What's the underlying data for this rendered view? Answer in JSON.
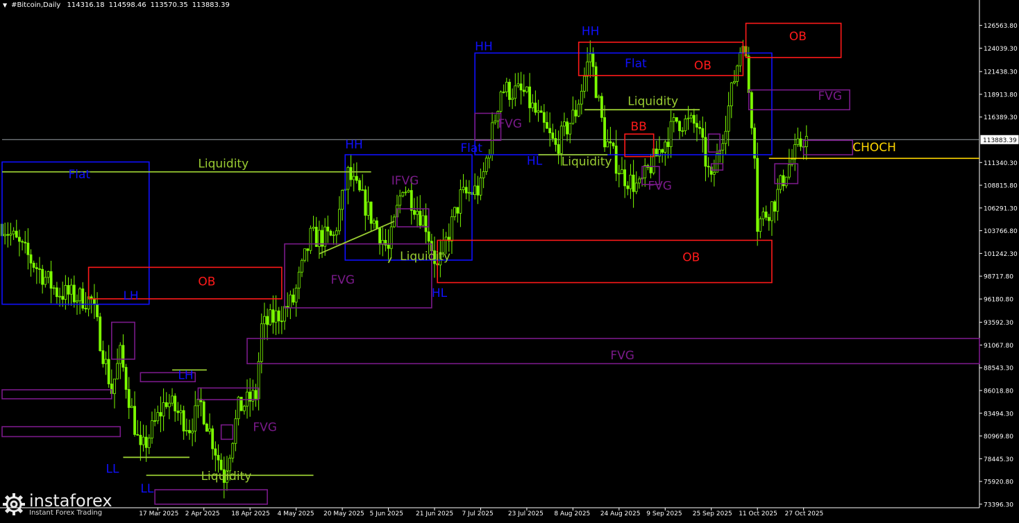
{
  "header": {
    "menu_icon": "triangle-down-icon",
    "symbol": "#Bitcoin,Daily",
    "ohlc": [
      "114316.18",
      "114598.46",
      "113570.35",
      "113883.39"
    ]
  },
  "current_price": "113883.39",
  "colors": {
    "background": "#000000",
    "candle": "#7CFC00",
    "grid_axis": "#ffffff",
    "blue_zone": "#1010ff",
    "red_zone": "#ff1a1a",
    "purple_zone": "#7a1a8a",
    "liquidity": "#9acd32",
    "choch": "#ffd700",
    "price_line": "#9aa0a6"
  },
  "logo": {
    "icon": "gear-logo-icon",
    "name": "instaforex",
    "tagline": "Instant Forex Trading"
  },
  "chart_data": {
    "type": "candlestick",
    "title": "",
    "symbol": "#Bitcoin",
    "timeframe": "Daily",
    "ylim": [
      73000,
      128000
    ],
    "y_ticks": [
      "126563.80",
      "124039.30",
      "121438.30",
      "118913.80",
      "116389.30",
      "113883.39",
      "111340.30",
      "108815.80",
      "106291.30",
      "103766.80",
      "101242.30",
      "98717.80",
      "96180.80",
      "93592.30",
      "91067.80",
      "88543.30",
      "86018.80",
      "83494.30",
      "80969.80",
      "78445.30",
      "75920.80",
      "73396.30"
    ],
    "x_ticks": [
      "17 Mar 2025",
      "2 Apr 2025",
      "18 Apr 2025",
      "4 May 2025",
      "20 May 2025",
      "5 Jun 2025",
      "21 Jun 2025",
      "7 Jul 2025",
      "23 Jul 2025",
      "8 Aug 2025",
      "24 Aug 2025",
      "9 Sep 2025",
      "25 Sep 2025",
      "11 Oct 2025",
      "27 Oct 2025"
    ],
    "price_path": [
      [
        "2025-01-22",
        104500
      ],
      [
        "2025-02-01",
        100500
      ],
      [
        "2025-02-10",
        97000
      ],
      [
        "2025-02-22",
        96000
      ],
      [
        "2025-03-01",
        86000
      ],
      [
        "2025-03-04",
        90000
      ],
      [
        "2025-03-11",
        79000
      ],
      [
        "2025-03-20",
        85000
      ],
      [
        "2025-03-28",
        82000
      ],
      [
        "2025-04-01",
        84500
      ],
      [
        "2025-04-09",
        76500
      ],
      [
        "2025-04-14",
        84000
      ],
      [
        "2025-04-20",
        85500
      ],
      [
        "2025-04-22",
        93000
      ],
      [
        "2025-04-30",
        95000
      ],
      [
        "2025-05-03",
        96000
      ],
      [
        "2025-05-09",
        103000
      ],
      [
        "2025-05-17",
        103000
      ],
      [
        "2025-05-22",
        110000
      ],
      [
        "2025-05-29",
        106000
      ],
      [
        "2025-06-05",
        101500
      ],
      [
        "2025-06-10",
        109000
      ],
      [
        "2025-06-18",
        104500
      ],
      [
        "2025-06-22",
        99500
      ],
      [
        "2025-06-30",
        107500
      ],
      [
        "2025-07-07",
        108500
      ],
      [
        "2025-07-14",
        119500
      ],
      [
        "2025-07-22",
        119000
      ],
      [
        "2025-08-02",
        113000
      ],
      [
        "2025-08-09",
        117000
      ],
      [
        "2025-08-14",
        123500
      ],
      [
        "2025-08-19",
        114000
      ],
      [
        "2025-08-25",
        110000
      ],
      [
        "2025-08-31",
        108500
      ],
      [
        "2025-09-04",
        111000
      ],
      [
        "2025-09-13",
        116000
      ],
      [
        "2025-09-20",
        115500
      ],
      [
        "2025-09-25",
        109000
      ],
      [
        "2025-10-01",
        117500
      ],
      [
        "2025-10-06",
        125500
      ],
      [
        "2025-10-10",
        113000
      ],
      [
        "2025-10-11",
        104500
      ],
      [
        "2025-10-17",
        107000
      ],
      [
        "2025-10-21",
        110500
      ],
      [
        "2025-10-27",
        114000
      ],
      [
        "2025-10-28",
        113883
      ]
    ],
    "zones": [
      {
        "kind": "blue",
        "label": "Flat",
        "x0": "2025-01-22",
        "x1": "2025-03-14",
        "y0": 95600,
        "y1": 111400
      },
      {
        "kind": "blue",
        "label": "Flat",
        "x0": "2025-05-21",
        "x1": "2025-07-04",
        "y0": 100500,
        "y1": 112200
      },
      {
        "kind": "blue",
        "label": "Flat",
        "x0": "2025-07-05",
        "x1": "2025-10-16",
        "y0": 112200,
        "y1": 123500
      },
      {
        "kind": "red",
        "label": "OB",
        "x0": "2025-02-21",
        "x1": "2025-04-29",
        "y0": 96200,
        "y1": 99700
      },
      {
        "kind": "red",
        "label": "OB",
        "x0": "2025-06-22",
        "x1": "2025-10-16",
        "y0": 98000,
        "y1": 102700
      },
      {
        "kind": "red",
        "label": "OB",
        "x0": "2025-08-10",
        "x1": "2025-10-06",
        "y0": 121000,
        "y1": 124700
      },
      {
        "kind": "red",
        "label": "OB",
        "x0": "2025-10-07",
        "x1": "2025-11-09",
        "y0": 123000,
        "y1": 126800
      },
      {
        "kind": "red",
        "label": "BB",
        "x0": "2025-08-26",
        "x1": "2025-09-05",
        "y0": 112000,
        "y1": 114500
      },
      {
        "kind": "purple",
        "label": "FVG",
        "x0": "2025-04-30",
        "x1": "2025-06-20",
        "y0": 95200,
        "y1": 102300
      },
      {
        "kind": "purple",
        "label": "FVG",
        "x0": "2025-04-17",
        "x1": "2025-12-27",
        "y0": 89000,
        "y1": 91800
      },
      {
        "kind": "purple",
        "label": "FVG",
        "x0": "2025-07-05",
        "x1": "2025-07-14",
        "y0": 113800,
        "y1": 116800
      },
      {
        "kind": "purple",
        "label": "FVG",
        "x0": "2025-10-08",
        "x1": "2025-11-12",
        "y0": 117200,
        "y1": 119400
      },
      {
        "kind": "purple",
        "label": "FVG",
        "x0": "2025-09-01",
        "x1": "2025-09-07",
        "y0": 108900,
        "y1": 110900
      },
      {
        "kind": "purple",
        "label": "FVG",
        "x0": "2025-04-08",
        "x1": "2025-04-12",
        "y0": 80600,
        "y1": 82200
      },
      {
        "kind": "purple",
        "label": "IFVG",
        "x0": "2025-06-08",
        "x1": "2025-06-19",
        "y0": 104200,
        "y1": 106200
      },
      {
        "kind": "purple",
        "label": "",
        "x0": "2025-03-01",
        "x1": "2025-03-09",
        "y0": 89500,
        "y1": 93600
      },
      {
        "kind": "purple",
        "label": "",
        "x0": "2025-03-11",
        "x1": "2025-03-30",
        "y0": 87000,
        "y1": 88000
      },
      {
        "kind": "purple",
        "label": "",
        "x0": "2025-03-31",
        "x1": "2025-04-21",
        "y0": 85000,
        "y1": 86300
      },
      {
        "kind": "purple",
        "label": "",
        "x0": "2025-09-24",
        "x1": "2025-09-28",
        "y0": 112500,
        "y1": 114500
      },
      {
        "kind": "purple",
        "label": "",
        "x0": "2025-09-25",
        "x1": "2025-09-29",
        "y0": 110500,
        "y1": 111200
      },
      {
        "kind": "purple",
        "label": "",
        "x0": "2025-10-17",
        "x1": "2025-10-25",
        "y0": 109000,
        "y1": 111200
      },
      {
        "kind": "purple",
        "label": "",
        "x0": "2025-10-27",
        "x1": "2025-11-13",
        "y0": 112200,
        "y1": 113800
      },
      {
        "kind": "purple",
        "label": "",
        "x0": "2025-01-22",
        "x1": "2025-03-04",
        "y0": 80900,
        "y1": 82000
      },
      {
        "kind": "purple",
        "label": "",
        "x0": "2025-01-22",
        "x1": "2025-03-01",
        "y0": 85100,
        "y1": 86100
      },
      {
        "kind": "purple",
        "label": "",
        "x0": "2025-03-16",
        "x1": "2025-04-24",
        "y0": 73396,
        "y1": 75000
      }
    ],
    "liquidity_lines": [
      {
        "label": "Liquidity",
        "x0": "2025-01-22",
        "x1": "2025-05-30",
        "y": 110300
      },
      {
        "label": "",
        "x0": "2025-03-22",
        "x1": "2025-04-03",
        "y": 88300
      },
      {
        "label": "",
        "x0": "2025-03-05",
        "x1": "2025-03-28",
        "y": 78600
      },
      {
        "label": "Liquidity",
        "x0": "2025-03-13",
        "x1": "2025-05-10",
        "y": 76600
      },
      {
        "label": "Liquidity",
        "x0": "2025-08-12",
        "x1": "2025-09-21",
        "y": 117200
      },
      {
        "label": "Liquidity",
        "x0": "2025-07-27",
        "x1": "2025-08-20",
        "y": 112200
      },
      {
        "label": "Liquidity",
        "x0": "2025-05-12",
        "x1": "2025-06-07",
        "y0": 101200,
        "y1": 104800
      },
      {
        "label": "",
        "x0": "2025-06-05",
        "x1": "2025-06-06",
        "y0": 100200,
        "y1": 100800
      }
    ],
    "choch": {
      "label": "CHOCH",
      "x0": "2025-10-15",
      "y": 111800
    },
    "structure_labels": [
      {
        "text": "HH",
        "x": "2025-05-21",
        "y": 112900
      },
      {
        "text": "HH",
        "x": "2025-07-05",
        "y": 123800
      },
      {
        "text": "HH",
        "x": "2025-08-11",
        "y": 125500
      },
      {
        "text": "HL",
        "x": "2025-06-20",
        "y": 96400
      },
      {
        "text": "HL",
        "x": "2025-07-23",
        "y": 111100
      },
      {
        "text": "LH",
        "x": "2025-03-05",
        "y": 96100
      },
      {
        "text": "LH",
        "x": "2025-03-24",
        "y": 87300
      },
      {
        "text": "LL",
        "x": "2025-02-27",
        "y": 76900
      },
      {
        "text": "LL",
        "x": "2025-03-11",
        "y": 74700
      }
    ],
    "text_labels": [
      {
        "text": "Flat",
        "x": "2025-02-14",
        "y": 109600,
        "color": "blue"
      },
      {
        "text": "Flat",
        "x": "2025-06-30",
        "y": 112500,
        "color": "blue"
      },
      {
        "text": "Flat",
        "x": "2025-08-26",
        "y": 121900,
        "color": "blue"
      },
      {
        "text": "OB",
        "x": "2025-03-31",
        "y": 97700,
        "color": "red"
      },
      {
        "text": "OB",
        "x": "2025-09-19",
        "y": 121700,
        "color": "red"
      },
      {
        "text": "OB",
        "x": "2025-10-22",
        "y": 124900,
        "color": "red"
      },
      {
        "text": "OB",
        "x": "2025-09-15",
        "y": 100400,
        "color": "red"
      },
      {
        "text": "BB",
        "x": "2025-08-28",
        "y": 114900,
        "color": "red"
      },
      {
        "text": "FVG",
        "x": "2025-05-16",
        "y": 97900,
        "color": "purple"
      },
      {
        "text": "FVG",
        "x": "2025-08-21",
        "y": 89500,
        "color": "purple"
      },
      {
        "text": "FVG",
        "x": "2025-07-13",
        "y": 115200,
        "color": "purple"
      },
      {
        "text": "FVG",
        "x": "2025-11-01",
        "y": 118300,
        "color": "purple"
      },
      {
        "text": "FVG",
        "x": "2025-09-03",
        "y": 108300,
        "color": "purple"
      },
      {
        "text": "FVG",
        "x": "2025-04-19",
        "y": 81500,
        "color": "purple"
      },
      {
        "text": "IFVG",
        "x": "2025-06-06",
        "y": 108900,
        "color": "purple"
      },
      {
        "text": "Liquidity",
        "x": "2025-03-31",
        "y": 110800,
        "color": "green"
      },
      {
        "text": "Liquidity",
        "x": "2025-04-01",
        "y": 76100,
        "color": "green"
      },
      {
        "text": "Liquidity",
        "x": "2025-06-09",
        "y": 100500,
        "color": "green"
      },
      {
        "text": "Liquidity",
        "x": "2025-08-27",
        "y": 117700,
        "color": "green"
      },
      {
        "text": "Liquidity",
        "x": "2025-08-04",
        "y": 111000,
        "color": "green"
      },
      {
        "text": "CHOCH",
        "x": "2025-11-13",
        "y": 112600,
        "color": "yellow"
      }
    ]
  }
}
